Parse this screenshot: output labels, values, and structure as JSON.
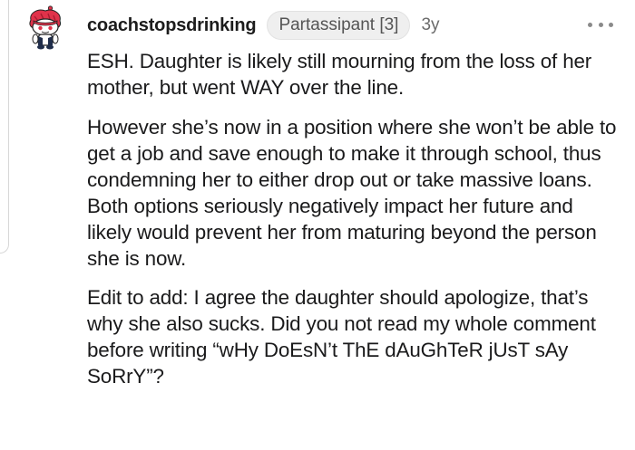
{
  "comment": {
    "username": "coachstopsdrinking",
    "flair": "Partassipant [3]",
    "age": "3y",
    "more_icon": "more-horizontal-icon",
    "paragraphs": [
      "ESH. Daughter is likely still mourning from the loss of her mother, but went WAY over the line.",
      "However she’s now in a position where she won’t be able to get a job and save enough to make it through school, thus condemning her to either drop out or take massive loans. Both options seriously negatively impact her future and likely would prevent her from maturing beyond the person she is now.",
      "Edit to add: I agree the daughter should apologize, that’s why she also sucks. Did you not read my whole comment before writing “wHy DoEsN’t ThE dAuGhTeR jUsT sAy SoRrY”?"
    ]
  },
  "colors": {
    "text": "#1a1a1b",
    "meta": "#6b6b6b",
    "flair_bg": "#efefef",
    "avatar_hair": "#e0324a"
  }
}
